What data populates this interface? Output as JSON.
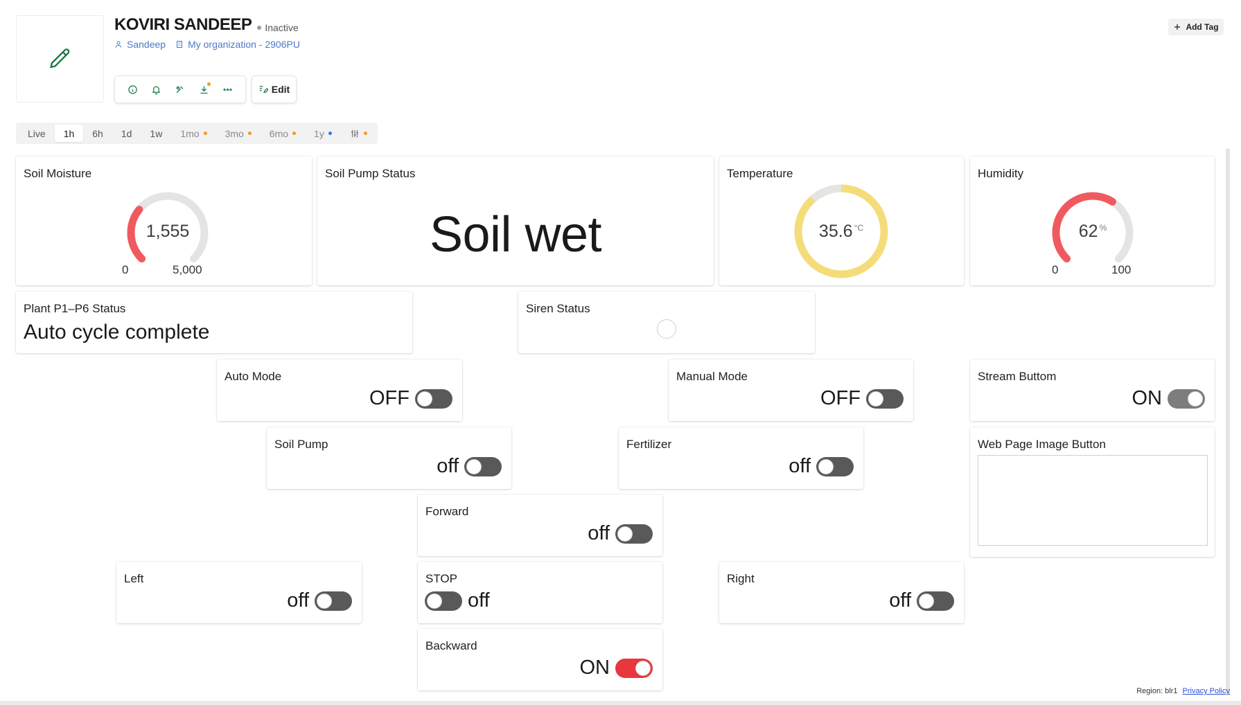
{
  "header": {
    "title": "KOVIRI SANDEEP",
    "status": "Inactive",
    "owner": "Sandeep",
    "organization": "My organization - 2906PU",
    "edit_label": "Edit",
    "add_tag_label": "Add Tag"
  },
  "range_tabs": [
    {
      "label": "Live"
    },
    {
      "label": "1h"
    },
    {
      "label": "6h"
    },
    {
      "label": "1d"
    },
    {
      "label": "1w"
    },
    {
      "label": "1mo"
    },
    {
      "label": "3mo"
    },
    {
      "label": "6mo"
    },
    {
      "label": "1y"
    }
  ],
  "range_selected": "1h",
  "colors": {
    "accent_green": "#1b7a46",
    "link_blue": "#4a78c8",
    "gauge_red": "#f05a5f",
    "gauge_yellow": "#f5dc7a",
    "gauge_track": "#e4e4e4",
    "switch_on_red": "#e8373f"
  },
  "widgets": {
    "soil_moisture": {
      "title": "Soil Moisture",
      "value": "1,555",
      "min": "0",
      "max": "5,000",
      "fraction": 0.311
    },
    "soil_pump_status": {
      "title": "Soil Pump Status",
      "value": "Soil wet"
    },
    "temperature": {
      "title": "Temperature",
      "value": "35.6",
      "unit": "°C"
    },
    "humidity": {
      "title": "Humidity",
      "value": "62",
      "unit": "%",
      "min": "0",
      "max": "100",
      "fraction": 0.62
    },
    "plant_status": {
      "title": "Plant P1–P6 Status",
      "value": "Auto cycle complete"
    },
    "siren_status": {
      "title": "Siren Status"
    },
    "auto_mode": {
      "title": "Auto Mode",
      "state": "OFF"
    },
    "manual_mode": {
      "title": "Manual Mode",
      "state": "OFF"
    },
    "stream_button": {
      "title": "Stream Buttom",
      "state": "ON"
    },
    "soil_pump": {
      "title": "Soil Pump",
      "state": "off"
    },
    "fertilizer": {
      "title": "Fertilizer",
      "state": "off"
    },
    "web_page_image_button": {
      "title": "Web Page Image Button"
    },
    "forward": {
      "title": "Forward",
      "state": "off"
    },
    "left": {
      "title": "Left",
      "state": "off"
    },
    "stop": {
      "title": "STOP",
      "state": "off"
    },
    "right": {
      "title": "Right",
      "state": "off"
    },
    "backward": {
      "title": "Backward",
      "state": "ON"
    }
  },
  "footer": {
    "region": "Region: blr1",
    "privacy": "Privacy Policy"
  }
}
